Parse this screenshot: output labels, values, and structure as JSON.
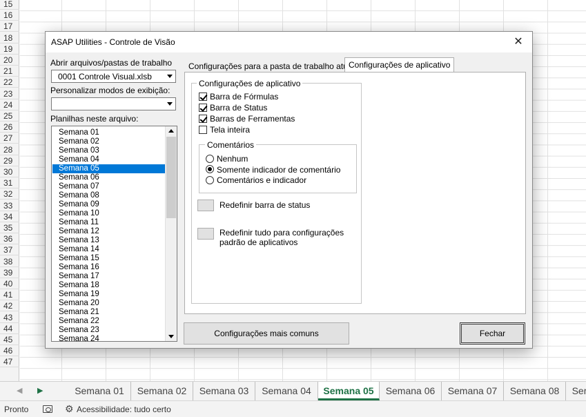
{
  "excel": {
    "row_numbers": [
      "15",
      "16",
      "17",
      "18",
      "19",
      "20",
      "21",
      "22",
      "23",
      "24",
      "25",
      "26",
      "27",
      "28",
      "29",
      "30",
      "31",
      "32",
      "33",
      "34",
      "35",
      "36",
      "37",
      "38",
      "39",
      "40",
      "41",
      "42",
      "43",
      "44",
      "45",
      "46",
      "47"
    ],
    "sheet_tabs": [
      "Semana 01",
      "Semana 02",
      "Semana 03",
      "Semana 04",
      "Semana 05",
      "Semana 06",
      "Semana 07",
      "Semana 08",
      "Ser"
    ],
    "active_sheet": "Semana 05",
    "status_ready": "Pronto",
    "status_accessibility": "Acessibilidade: tudo certo"
  },
  "dialog": {
    "title": "ASAP Utilities - Controle de Visão",
    "open_files_label": "Abrir arquivos/pastas de trabalho",
    "open_files_value": "0001 Controle Visual.xlsb",
    "custom_views_label": "Personalizar modos de exibição:",
    "custom_views_value": "",
    "sheets_label": "Planilhas neste arquivo:",
    "sheets": [
      "Semana 01",
      "Semana 02",
      "Semana 03",
      "Semana 04",
      "Semana 05",
      "Semana 06",
      "Semana 07",
      "Semana 08",
      "Semana 09",
      "Semana 10",
      "Semana 11",
      "Semana 12",
      "Semana 13",
      "Semana 14",
      "Semana 15",
      "Semana 16",
      "Semana 17",
      "Semana 18",
      "Semana 19",
      "Semana 20",
      "Semana 21",
      "Semana 22",
      "Semana 23",
      "Semana 24"
    ],
    "selected_sheet": "Semana 05",
    "tabs": [
      "Configurações para a pasta de trabalho atual",
      "Configurações de aplicativo"
    ],
    "active_tab": "Configurações de aplicativo",
    "app_group_title": "Configurações de aplicativo",
    "checkboxes": [
      {
        "label": "Barra de Fórmulas",
        "checked": true
      },
      {
        "label": "Barra de Status",
        "checked": true
      },
      {
        "label": "Barras de Ferramentas",
        "checked": true
      },
      {
        "label": "Tela inteira",
        "checked": false
      }
    ],
    "comments_group_title": "Comentários",
    "radios": [
      {
        "label": "Nenhum",
        "selected": false
      },
      {
        "label": "Somente indicador de comentário",
        "selected": true
      },
      {
        "label": "Comentários e indicador",
        "selected": false
      }
    ],
    "reset_status_label": "Redefinir barra de status",
    "reset_all_label_line1": "Redefinir tudo para configurações",
    "reset_all_label_line2": "padrão de aplicativos",
    "common_settings_button": "Configurações mais comuns",
    "close_button": "Fechar"
  }
}
